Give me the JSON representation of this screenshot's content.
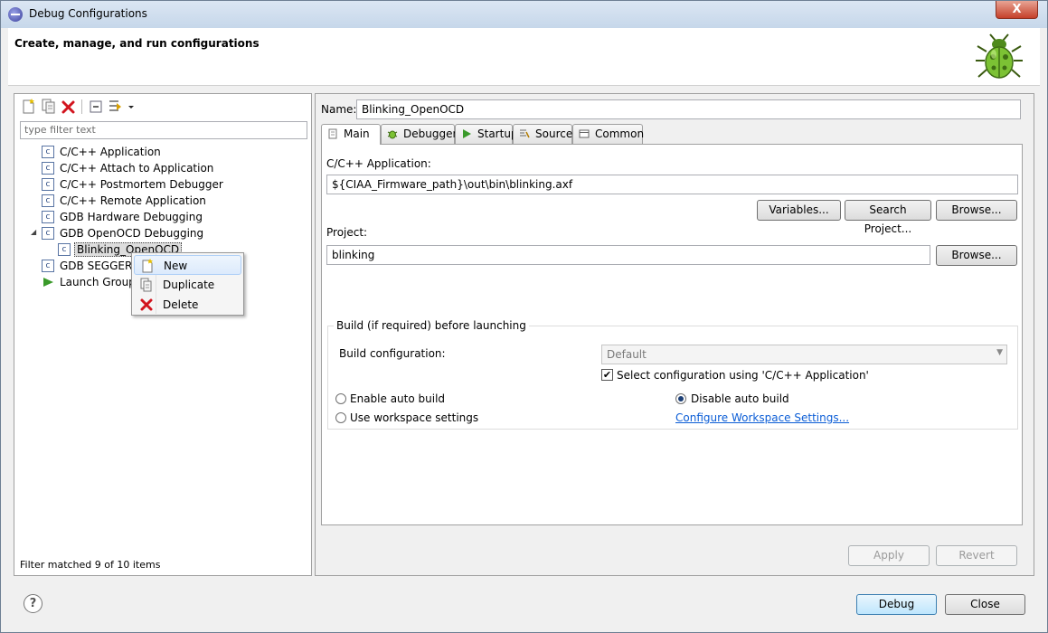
{
  "window": {
    "title": "Debug Configurations",
    "close_glyph": "X"
  },
  "header": {
    "title": "Create, manage, and run configurations",
    "icon": "bug-icon"
  },
  "left": {
    "filter_placeholder": "type filter text",
    "tree": [
      {
        "label": "C/C++ Application",
        "icon": "c-icon"
      },
      {
        "label": "C/C++ Attach to Application",
        "icon": "c-icon"
      },
      {
        "label": "C/C++ Postmortem Debugger",
        "icon": "c-icon"
      },
      {
        "label": "C/C++ Remote Application",
        "icon": "c-icon"
      },
      {
        "label": "GDB Hardware Debugging",
        "icon": "c-icon"
      },
      {
        "label": "GDB OpenOCD Debugging",
        "icon": "c-icon",
        "expanded": true
      },
      {
        "label": "Blinking_OpenOCD",
        "icon": "c-icon",
        "selected": true
      },
      {
        "label": "GDB SEGGER J-",
        "icon": "c-icon"
      },
      {
        "label": "Launch Group",
        "icon": "launch-icon"
      }
    ],
    "status": "Filter matched 9 of 10 items"
  },
  "context_menu": {
    "items": [
      {
        "label": "New",
        "icon": "new-icon"
      },
      {
        "label": "Duplicate",
        "icon": "duplicate-icon"
      },
      {
        "label": "Delete",
        "icon": "delete-icon"
      }
    ]
  },
  "config": {
    "name_label": "Name:",
    "name_value": "Blinking_OpenOCD",
    "tabs": [
      {
        "label": "Main",
        "active": true
      },
      {
        "label": "Debugger"
      },
      {
        "label": "Startup"
      },
      {
        "label": "Source"
      },
      {
        "label": "Common"
      }
    ],
    "main": {
      "app_label": "C/C++ Application:",
      "app_value": "${CIAA_Firmware_path}\\out\\bin\\blinking.axf",
      "variables_btn": "Variables...",
      "search_project_btn": "Search Project...",
      "browse_btn": "Browse...",
      "project_label": "Project:",
      "project_value": "blinking",
      "project_browse_btn": "Browse...",
      "build_group_title": "Build (if required) before launching",
      "build_config_label": "Build configuration:",
      "build_config_value": "Default",
      "select_config_label": "Select configuration using 'C/C++ Application'",
      "enable_auto_build": "Enable auto build",
      "disable_auto_build": "Disable auto build",
      "use_workspace": "Use workspace settings",
      "configure_workspace_link": "Configure Workspace Settings..."
    },
    "apply_btn": "Apply",
    "revert_btn": "Revert"
  },
  "footer": {
    "help_glyph": "?",
    "debug_btn": "Debug",
    "close_btn": "Close"
  }
}
